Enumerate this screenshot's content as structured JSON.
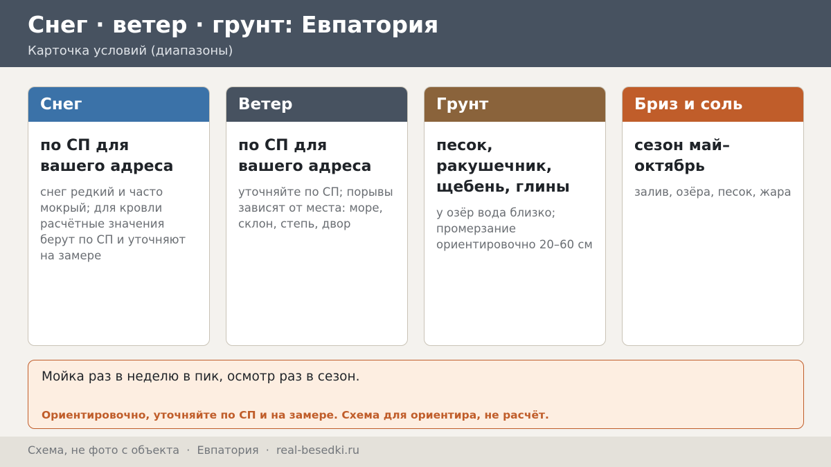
{
  "header": {
    "title": "Снег · ветер · грунт: Евпатория",
    "subtitle": "Карточка условий (диапазоны)"
  },
  "cards": [
    {
      "title": "Снег",
      "color": "#3b72a8",
      "main": "по СП для вашего адреса",
      "note": "снег редкий и часто мокрый; для кровли расчётные значения берут по СП и уточняют на замере"
    },
    {
      "title": "Ветер",
      "color": "#475260",
      "main": "по СП для вашего адреса",
      "note": "уточняйте по СП; порывы зависят от места: море, склон, степь, двор"
    },
    {
      "title": "Грунт",
      "color": "#8a633b",
      "main": "песок, ракушечник, щебень, глины",
      "note": "у озёр вода близко; промерзание ориентировочно 20–60 см"
    },
    {
      "title": "Бриз и соль",
      "color": "#c05d2a",
      "main": "сезон май–октябрь",
      "note": "залив, озёра, песок, жара"
    }
  ],
  "note_box": {
    "main": "Мойка раз в неделю в пик, осмотр раз в сезон.",
    "warning": "Ориентировочно, уточняйте по СП и на замере. Схема для ориентира, не расчёт.",
    "accent": "#c05d2a"
  },
  "footer": {
    "text": "Схема, не фото с объекта  ·  Евпатория  ·  real-besedki.ru"
  }
}
